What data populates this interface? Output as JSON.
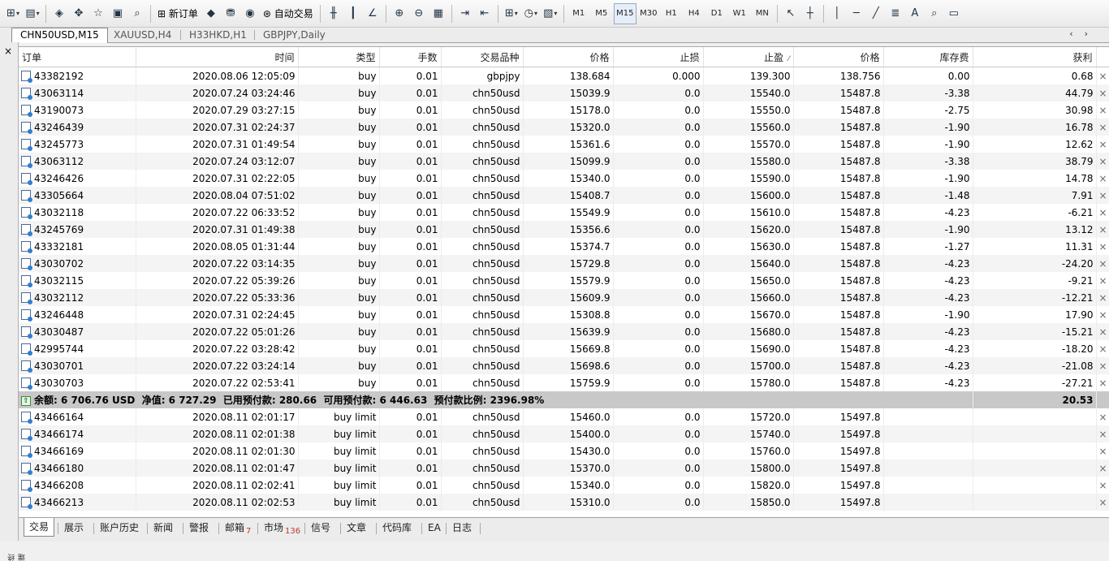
{
  "toolbar": {
    "new_order_label": "新订单",
    "auto_trade_label": "自动交易",
    "timeframes": [
      "M1",
      "M5",
      "M15",
      "M30",
      "H1",
      "H4",
      "D1",
      "W1",
      "MN"
    ],
    "active_timeframe": "M15"
  },
  "chart_tabs": [
    "CHN50USD,M15",
    "XAUUSD,H4",
    "H33HKD,H1",
    "GBPJPY,Daily"
  ],
  "side_panel": {
    "title": "终端",
    "close_label": "×"
  },
  "columns": {
    "order": "订单",
    "time": "时间",
    "type": "类型",
    "lots": "手数",
    "symbol": "交易品种",
    "price": "价格",
    "sl": "止损",
    "tp": "止盈",
    "cur_price": "价格",
    "swap": "库存费",
    "profit": "获利"
  },
  "positions": [
    [
      "43382192",
      "2020.08.06 12:05:09",
      "buy",
      "0.01",
      "gbpjpy",
      "138.684",
      "0.000",
      "139.300",
      "138.756",
      "0.00",
      "0.68"
    ],
    [
      "43063114",
      "2020.07.24 03:24:46",
      "buy",
      "0.01",
      "chn50usd",
      "15039.9",
      "0.0",
      "15540.0",
      "15487.8",
      "-3.38",
      "44.79"
    ],
    [
      "43190073",
      "2020.07.29 03:27:15",
      "buy",
      "0.01",
      "chn50usd",
      "15178.0",
      "0.0",
      "15550.0",
      "15487.8",
      "-2.75",
      "30.98"
    ],
    [
      "43246439",
      "2020.07.31 02:24:37",
      "buy",
      "0.01",
      "chn50usd",
      "15320.0",
      "0.0",
      "15560.0",
      "15487.8",
      "-1.90",
      "16.78"
    ],
    [
      "43245773",
      "2020.07.31 01:49:54",
      "buy",
      "0.01",
      "chn50usd",
      "15361.6",
      "0.0",
      "15570.0",
      "15487.8",
      "-1.90",
      "12.62"
    ],
    [
      "43063112",
      "2020.07.24 03:12:07",
      "buy",
      "0.01",
      "chn50usd",
      "15099.9",
      "0.0",
      "15580.0",
      "15487.8",
      "-3.38",
      "38.79"
    ],
    [
      "43246426",
      "2020.07.31 02:22:05",
      "buy",
      "0.01",
      "chn50usd",
      "15340.0",
      "0.0",
      "15590.0",
      "15487.8",
      "-1.90",
      "14.78"
    ],
    [
      "43305664",
      "2020.08.04 07:51:02",
      "buy",
      "0.01",
      "chn50usd",
      "15408.7",
      "0.0",
      "15600.0",
      "15487.8",
      "-1.48",
      "7.91"
    ],
    [
      "43032118",
      "2020.07.22 06:33:52",
      "buy",
      "0.01",
      "chn50usd",
      "15549.9",
      "0.0",
      "15610.0",
      "15487.8",
      "-4.23",
      "-6.21"
    ],
    [
      "43245769",
      "2020.07.31 01:49:38",
      "buy",
      "0.01",
      "chn50usd",
      "15356.6",
      "0.0",
      "15620.0",
      "15487.8",
      "-1.90",
      "13.12"
    ],
    [
      "43332181",
      "2020.08.05 01:31:44",
      "buy",
      "0.01",
      "chn50usd",
      "15374.7",
      "0.0",
      "15630.0",
      "15487.8",
      "-1.27",
      "11.31"
    ],
    [
      "43030702",
      "2020.07.22 03:14:35",
      "buy",
      "0.01",
      "chn50usd",
      "15729.8",
      "0.0",
      "15640.0",
      "15487.8",
      "-4.23",
      "-24.20"
    ],
    [
      "43032115",
      "2020.07.22 05:39:26",
      "buy",
      "0.01",
      "chn50usd",
      "15579.9",
      "0.0",
      "15650.0",
      "15487.8",
      "-4.23",
      "-9.21"
    ],
    [
      "43032112",
      "2020.07.22 05:33:36",
      "buy",
      "0.01",
      "chn50usd",
      "15609.9",
      "0.0",
      "15660.0",
      "15487.8",
      "-4.23",
      "-12.21"
    ],
    [
      "43246448",
      "2020.07.31 02:24:45",
      "buy",
      "0.01",
      "chn50usd",
      "15308.8",
      "0.0",
      "15670.0",
      "15487.8",
      "-1.90",
      "17.90"
    ],
    [
      "43030487",
      "2020.07.22 05:01:26",
      "buy",
      "0.01",
      "chn50usd",
      "15639.9",
      "0.0",
      "15680.0",
      "15487.8",
      "-4.23",
      "-15.21"
    ],
    [
      "42995744",
      "2020.07.22 03:28:42",
      "buy",
      "0.01",
      "chn50usd",
      "15669.8",
      "0.0",
      "15690.0",
      "15487.8",
      "-4.23",
      "-18.20"
    ],
    [
      "43030701",
      "2020.07.22 03:24:14",
      "buy",
      "0.01",
      "chn50usd",
      "15698.6",
      "0.0",
      "15700.0",
      "15487.8",
      "-4.23",
      "-21.08"
    ],
    [
      "43030703",
      "2020.07.22 02:53:41",
      "buy",
      "0.01",
      "chn50usd",
      "15759.9",
      "0.0",
      "15780.0",
      "15487.8",
      "-4.23",
      "-27.21"
    ]
  ],
  "summary": {
    "text": "余额: 6 706.76 USD  净值: 6 727.29  已用预付款: 280.66  可用预付款: 6 446.63  预付款比例: 2396.98%",
    "profit": "20.53"
  },
  "pending": [
    [
      "43466164",
      "2020.08.11 02:01:17",
      "buy limit",
      "0.01",
      "chn50usd",
      "15460.0",
      "0.0",
      "15720.0",
      "15497.8",
      "",
      ""
    ],
    [
      "43466174",
      "2020.08.11 02:01:38",
      "buy limit",
      "0.01",
      "chn50usd",
      "15400.0",
      "0.0",
      "15740.0",
      "15497.8",
      "",
      ""
    ],
    [
      "43466169",
      "2020.08.11 02:01:30",
      "buy limit",
      "0.01",
      "chn50usd",
      "15430.0",
      "0.0",
      "15760.0",
      "15497.8",
      "",
      ""
    ],
    [
      "43466180",
      "2020.08.11 02:01:47",
      "buy limit",
      "0.01",
      "chn50usd",
      "15370.0",
      "0.0",
      "15800.0",
      "15497.8",
      "",
      ""
    ],
    [
      "43466208",
      "2020.08.11 02:02:41",
      "buy limit",
      "0.01",
      "chn50usd",
      "15340.0",
      "0.0",
      "15820.0",
      "15497.8",
      "",
      ""
    ],
    [
      "43466213",
      "2020.08.11 02:02:53",
      "buy limit",
      "0.01",
      "chn50usd",
      "15310.0",
      "0.0",
      "15850.0",
      "15497.8",
      "",
      ""
    ]
  ],
  "bottom_tabs": [
    {
      "label": "交易",
      "badge": ""
    },
    {
      "label": "展示",
      "badge": ""
    },
    {
      "label": "账户历史",
      "badge": ""
    },
    {
      "label": "新闻",
      "badge": ""
    },
    {
      "label": "警报",
      "badge": ""
    },
    {
      "label": "邮箱",
      "badge": "7"
    },
    {
      "label": "市场",
      "badge": "136"
    },
    {
      "label": "信号",
      "badge": ""
    },
    {
      "label": "文章",
      "badge": ""
    },
    {
      "label": "代码库",
      "badge": ""
    },
    {
      "label": "EA",
      "badge": ""
    },
    {
      "label": "日志",
      "badge": ""
    }
  ]
}
